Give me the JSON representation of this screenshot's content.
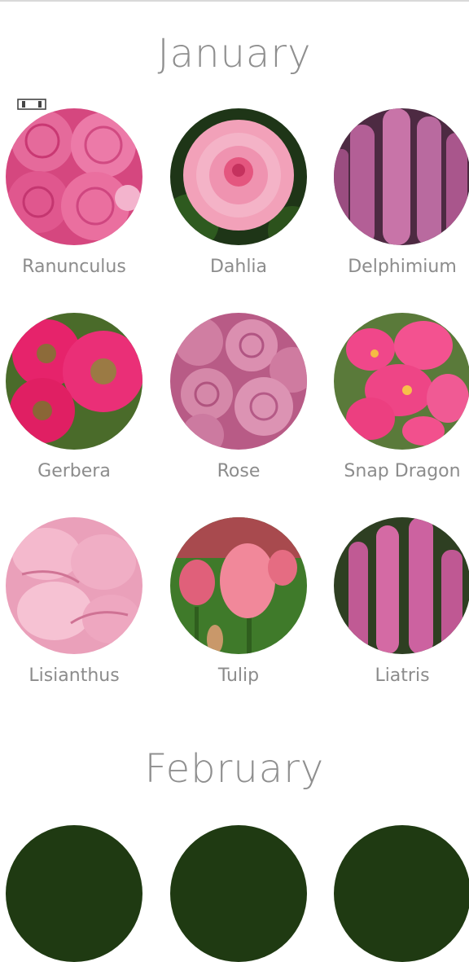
{
  "months": [
    {
      "name": "January",
      "flowers": [
        {
          "label": "Ranunculus"
        },
        {
          "label": "Dahlia"
        },
        {
          "label": "Delphimium"
        },
        {
          "label": "Gerbera"
        },
        {
          "label": "Rose"
        },
        {
          "label": "Snap Dragon"
        },
        {
          "label": "Lisianthus"
        },
        {
          "label": "Tulip"
        },
        {
          "label": "Liatris"
        }
      ]
    },
    {
      "name": "February",
      "flowers": []
    }
  ],
  "icons": {
    "badge": "battery-icon"
  },
  "colors": {
    "title": "#8f8f8f",
    "label": "#8c8c8c",
    "accent_pink": "#e8538f"
  }
}
